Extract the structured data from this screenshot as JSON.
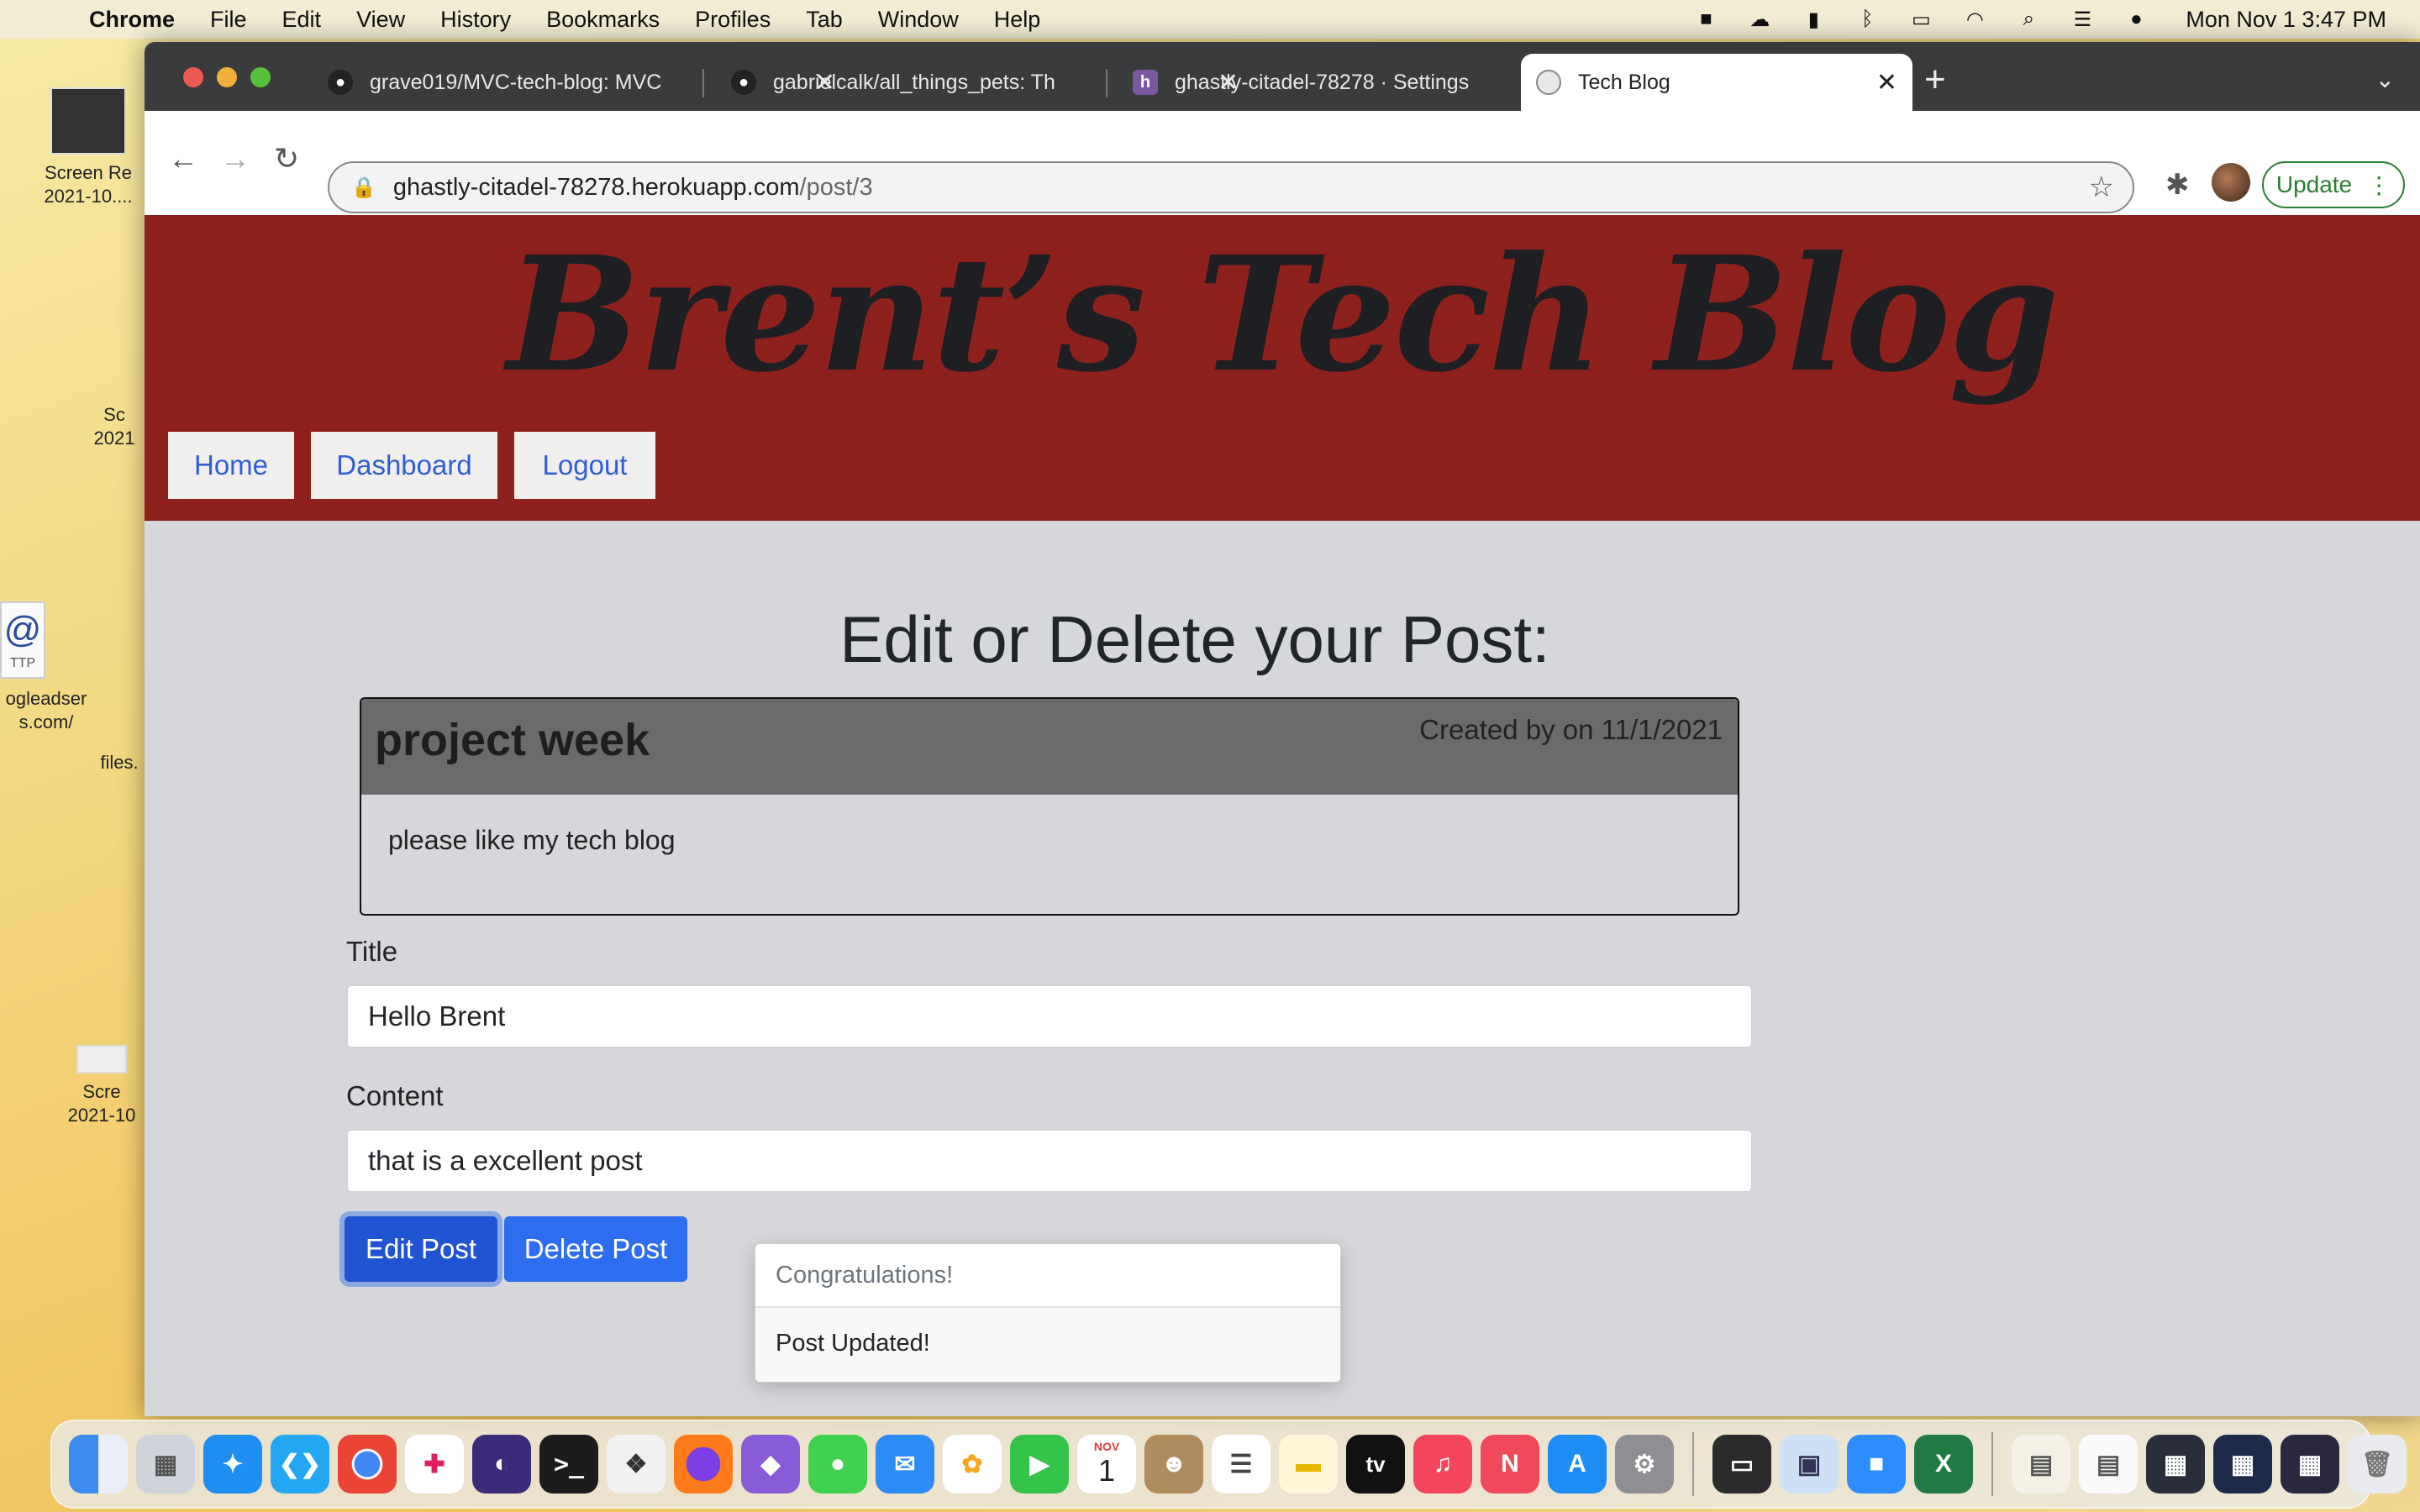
{
  "menubar": {
    "app_name": "Chrome",
    "items": [
      "File",
      "Edit",
      "View",
      "History",
      "Bookmarks",
      "Profiles",
      "Tab",
      "Window",
      "Help"
    ],
    "clock": "Mon Nov 1  3:47 PM"
  },
  "desktop": {
    "icons": [
      {
        "label_line1": "Screen Re",
        "label_line2": "2021-10...."
      },
      {
        "label_line1": "Sc",
        "label_line2": "2021"
      },
      {
        "label_line1": "ogleadser",
        "label_line2": "s.com/"
      },
      {
        "label_line1": "files.",
        "label_line2": ""
      },
      {
        "label_line1": "Scre",
        "label_line2": "2021-10"
      }
    ],
    "http_badge": "TTP"
  },
  "browser": {
    "tabs": [
      {
        "label": "grave019/MVC-tech-blog: MVC",
        "icon": "github-icon"
      },
      {
        "label": "gabrielcalk/all_things_pets: Th",
        "icon": "github-icon"
      },
      {
        "label": "ghastly-citadel-78278 · Settings",
        "icon": "heroku-icon"
      },
      {
        "label": "Tech Blog",
        "icon": "globe-icon"
      }
    ],
    "url_host": "ghastly-citadel-78278.herokuapp.com",
    "url_path": "/post/3",
    "update_label": "Update"
  },
  "site": {
    "title": "Brent’s Tech Blog",
    "nav": {
      "home": "Home",
      "dashboard": "Dashboard",
      "logout": "Logout"
    }
  },
  "main": {
    "heading": "Edit or Delete your Post:",
    "post": {
      "title": "project week",
      "meta": "Created by on 11/1/2021",
      "content": "please like my tech blog"
    },
    "form": {
      "title_label": "Title",
      "title_value": "Hello Brent",
      "content_label": "Content",
      "content_value": "that is a excellent post",
      "edit_label": "Edit Post",
      "delete_label": "Delete Post"
    },
    "toast": {
      "header": "Congratulations!",
      "body": "Post Updated!"
    }
  },
  "dock": {
    "calendar_month": "NOV",
    "calendar_day": "1",
    "tv_label": "tv"
  }
}
